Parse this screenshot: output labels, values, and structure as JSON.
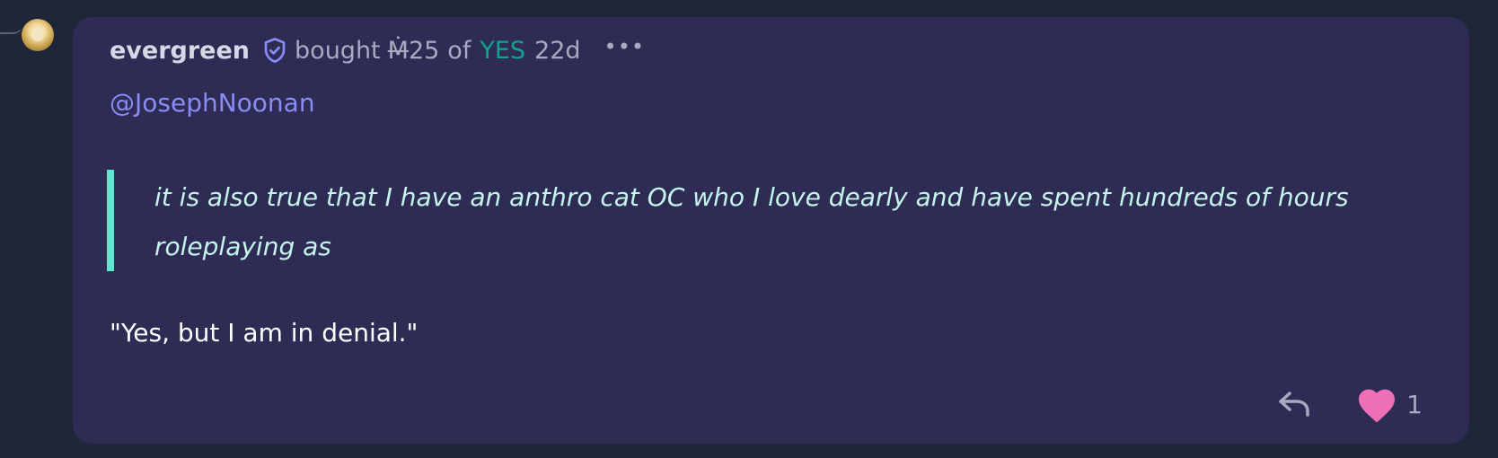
{
  "comment": {
    "username": "evergreen",
    "action": "bought",
    "currency_symbol": "Ṁ",
    "amount": "25",
    "of_word": "of",
    "outcome": "YES",
    "time": "22d",
    "mention": "@JosephNoonan",
    "quote": "it is also true that I have an anthro cat OC who I love dearly and have spent hundreds of hours roleplaying as",
    "reply": "\"Yes, but I am in denial.\"",
    "likes": "1"
  },
  "icons": {
    "verified": "shield-check-icon",
    "more": "more-options-icon",
    "reply": "reply-icon",
    "like": "heart-icon"
  },
  "colors": {
    "background": "#1e2638",
    "card": "#2e2c54",
    "mention": "#8a8cf5",
    "quote_bar": "#5ee6cf",
    "outcome": "#12a38d",
    "heart": "#f070b8"
  }
}
